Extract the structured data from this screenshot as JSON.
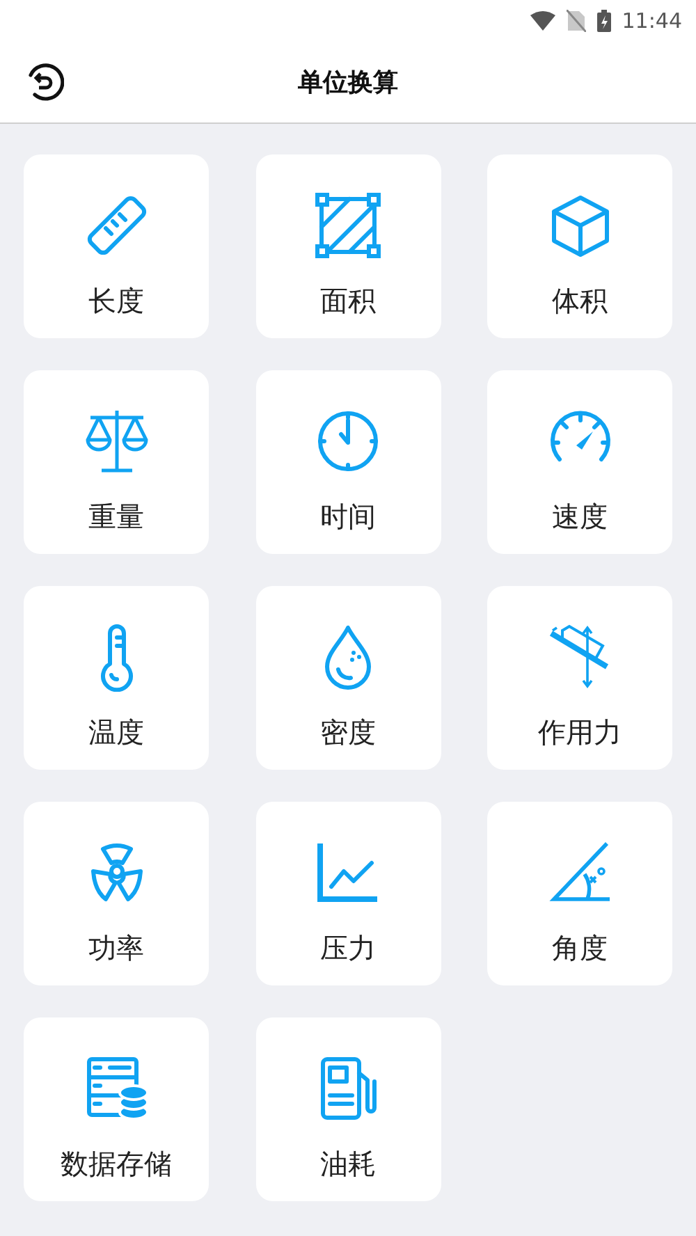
{
  "status_bar": {
    "time": "11:44"
  },
  "header": {
    "title": "单位换算"
  },
  "tiles": [
    {
      "label": "长度"
    },
    {
      "label": "面积"
    },
    {
      "label": "体积"
    },
    {
      "label": "重量"
    },
    {
      "label": "时间"
    },
    {
      "label": "速度"
    },
    {
      "label": "温度"
    },
    {
      "label": "密度"
    },
    {
      "label": "作用力"
    },
    {
      "label": "功率"
    },
    {
      "label": "压力"
    },
    {
      "label": "角度"
    },
    {
      "label": "数据存储"
    },
    {
      "label": "油耗"
    }
  ]
}
